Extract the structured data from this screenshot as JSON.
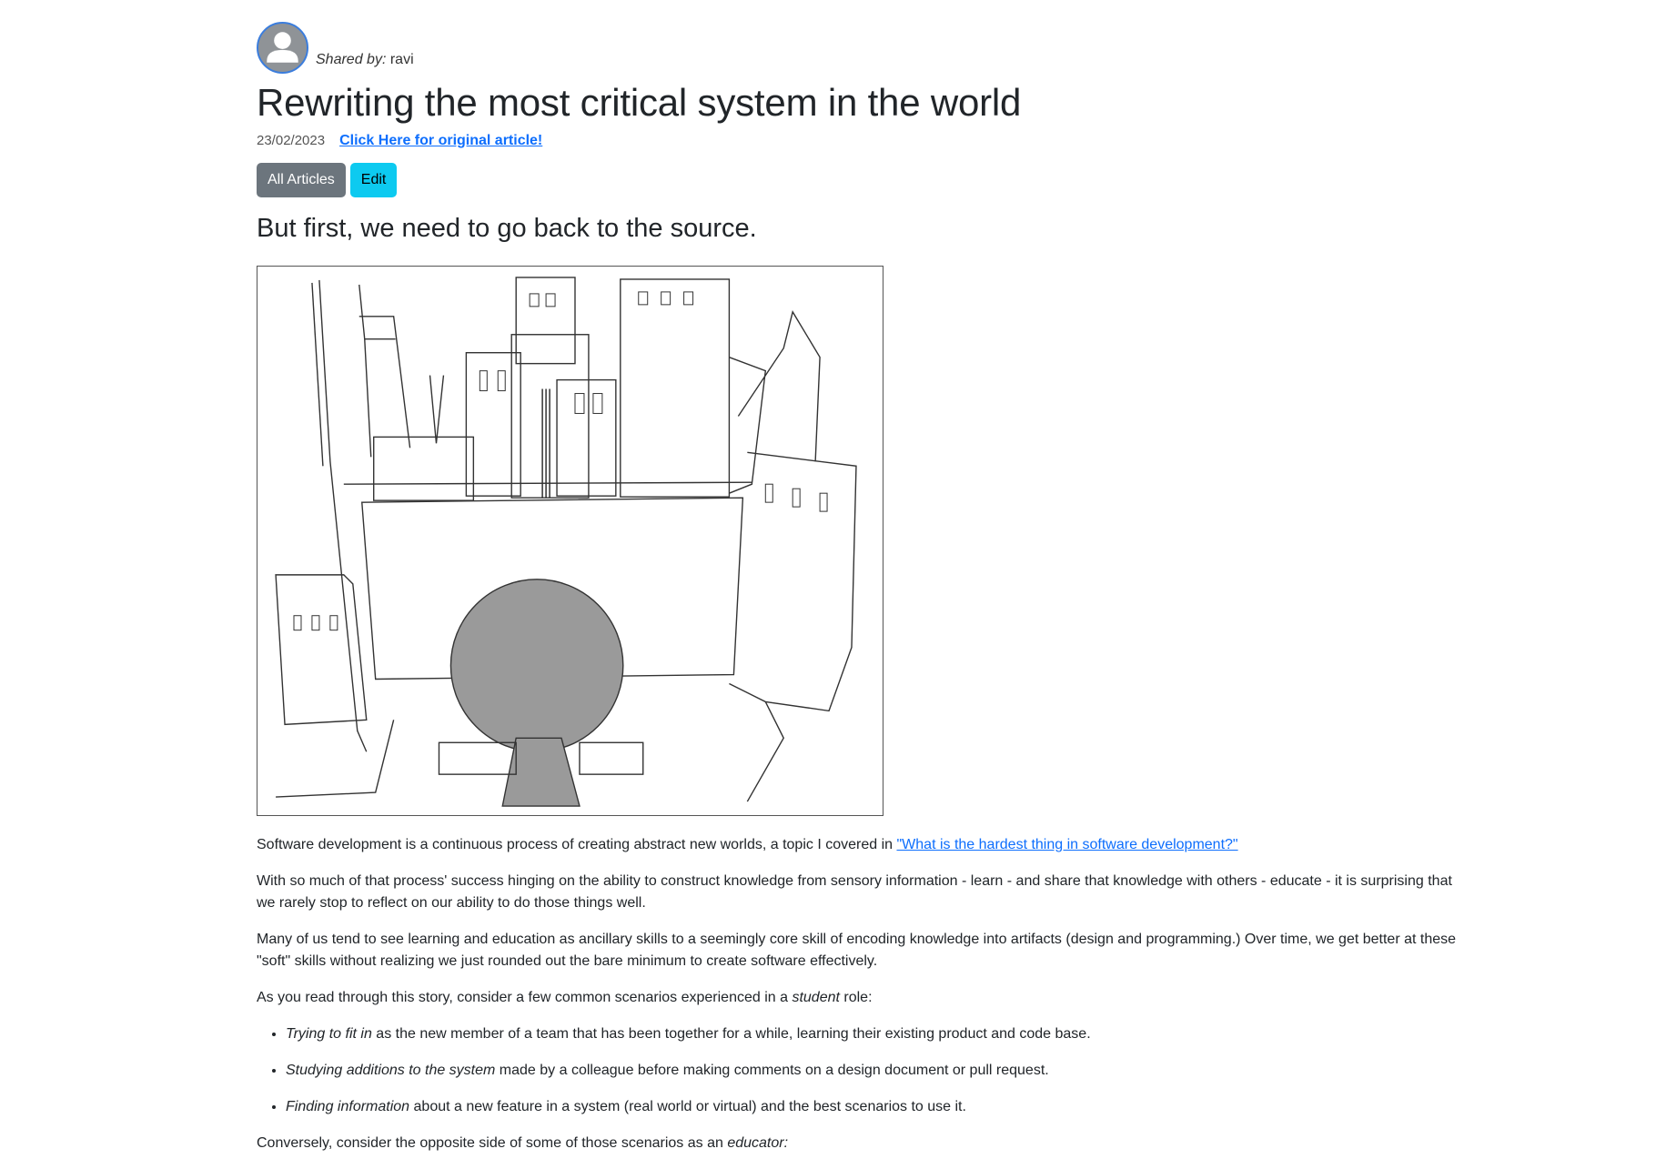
{
  "header": {
    "shared_by_label": "Shared by:",
    "shared_by_user": "ravi",
    "title": "Rewriting the most critical system in the world",
    "date": "23/02/2023",
    "original_link": "Click Here for original article!"
  },
  "buttons": {
    "all_articles": "All Articles",
    "edit": "Edit"
  },
  "colors": {
    "avatar_border": "#3b7ddd",
    "btn_secondary": "#6c757d",
    "btn_info": "#0dcaf0",
    "link": "#0d6efd"
  },
  "article": {
    "subtitle": "But first, we need to go back to the source.",
    "p1_text": "Software development is a continuous process of creating abstract new worlds, a topic I covered in ",
    "p1_link": "\"What is the hardest thing in software development?\"",
    "p2": "With so much of that process' success hinging on the ability to construct knowledge from sensory information - learn - and share that knowledge with others - educate - it is surprising that we rarely stop to reflect on our ability to do those things well.",
    "p3": "Many of us tend to see learning and education as ancillary skills to a seemingly core skill of encoding knowledge into artifacts (design and programming.) Over time, we get better at these \"soft\" skills without realizing we just rounded out the bare minimum to create software effectively.",
    "p4_pre": "As you read through this story, consider a few common scenarios experienced in a ",
    "p4_em": "student",
    "p4_post": " role:",
    "list": [
      {
        "em": "Trying to fit in",
        "text": " as the new member of a team that has been together for a while, learning their existing product and code base."
      },
      {
        "em": "Studying additions to the system",
        "text": " made by a colleague before making comments on a design document or pull request."
      },
      {
        "em": "Finding information",
        "text": " about a new feature in a system (real world or virtual) and the best scenarios to use it."
      }
    ],
    "p5_pre": "Conversely, consider the opposite side of some of those scenarios as an ",
    "p5_em": "educator:"
  }
}
